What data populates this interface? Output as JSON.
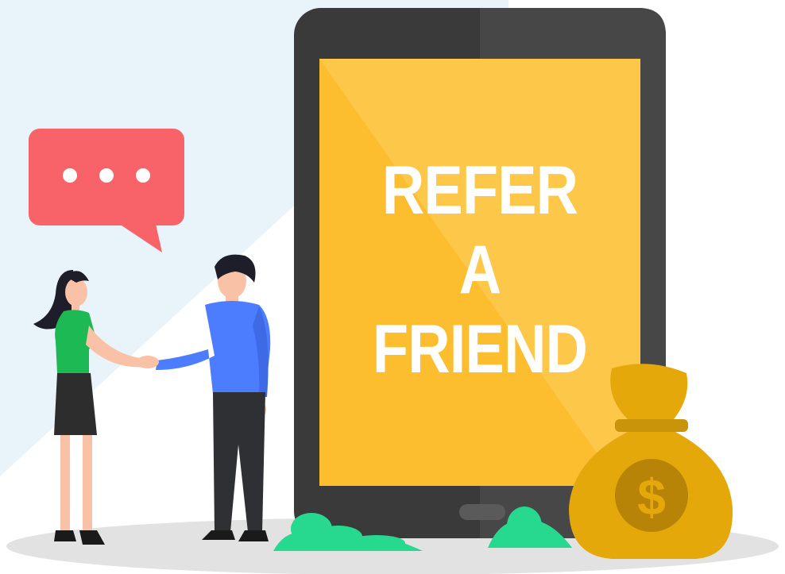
{
  "headline": {
    "line1": "REFER",
    "line2": "A",
    "line3": "FRIEND"
  },
  "icons": {
    "speech_bubble": "speech-bubble-icon",
    "money_bag": "money-bag-icon",
    "currency_symbol": "$"
  },
  "colors": {
    "background_tint": "#e8f3fa",
    "tablet_frame": "#3a3a3a",
    "screen": "#fcbd2f",
    "screen_highlight": "#fdc74a",
    "bubble": "#f76368",
    "bush": "#27d98f",
    "money_bag": "#e5a80b",
    "coin": "#b88408",
    "man_shirt": "#4c7cff",
    "woman_shirt": "#1db954",
    "floor": "#e2e2e2"
  }
}
